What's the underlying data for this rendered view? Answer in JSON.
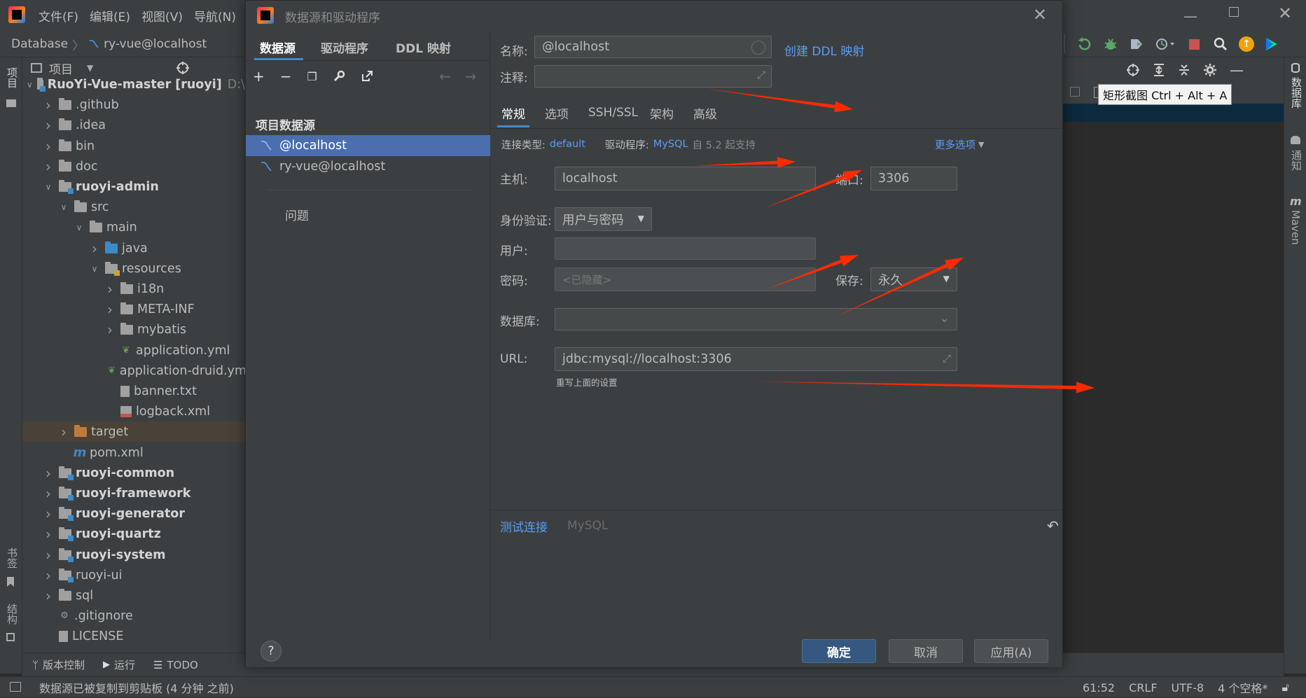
{
  "ide": {
    "menus": [
      "文件(F)",
      "编辑(E)",
      "视图(V)",
      "导航(N)"
    ],
    "breadcrumb": [
      "Database",
      "ry-vue@localhost"
    ],
    "project_header": "项目",
    "tooltip": "矩形截图 Ctrl + Alt + A",
    "left_strip": [
      "项目",
      "书签",
      "结构"
    ],
    "right_strip": [
      "数据库",
      "通知",
      "Maven"
    ],
    "tree": [
      {
        "label": "RuoYi-Vue-master",
        "suffix": "[ruoyi]",
        "path": "D:\\",
        "level": 0,
        "expanded": true,
        "icon": "module-folder",
        "bold": true
      },
      {
        "label": ".github",
        "level": 1,
        "icon": "folder"
      },
      {
        "label": ".idea",
        "level": 1,
        "icon": "folder"
      },
      {
        "label": "bin",
        "level": 1,
        "icon": "folder"
      },
      {
        "label": "doc",
        "level": 1,
        "icon": "folder"
      },
      {
        "label": "ruoyi-admin",
        "level": 1,
        "expanded": true,
        "icon": "module-folder",
        "bold": true
      },
      {
        "label": "src",
        "level": 2,
        "expanded": true,
        "icon": "folder"
      },
      {
        "label": "main",
        "level": 3,
        "expanded": true,
        "icon": "folder"
      },
      {
        "label": "java",
        "level": 4,
        "icon": "source-folder"
      },
      {
        "label": "resources",
        "level": 4,
        "expanded": true,
        "icon": "resources-folder"
      },
      {
        "label": "i18n",
        "level": 5,
        "icon": "folder"
      },
      {
        "label": "META-INF",
        "level": 5,
        "icon": "folder"
      },
      {
        "label": "mybatis",
        "level": 5,
        "icon": "folder"
      },
      {
        "label": "application.yml",
        "level": 5,
        "icon": "spring-config-file",
        "leaf": true
      },
      {
        "label": "application-druid.yml",
        "level": 5,
        "icon": "spring-config-file",
        "leaf": true
      },
      {
        "label": "banner.txt",
        "level": 5,
        "icon": "text-file",
        "leaf": true
      },
      {
        "label": "logback.xml",
        "level": 5,
        "icon": "xml-file",
        "leaf": true
      },
      {
        "label": "target",
        "level": 2,
        "icon": "excluded-folder",
        "highlight": true
      },
      {
        "label": "pom.xml",
        "level": 2,
        "icon": "maven-file",
        "leaf": true
      },
      {
        "label": "ruoyi-common",
        "level": 1,
        "icon": "module-folder",
        "bold": true
      },
      {
        "label": "ruoyi-framework",
        "level": 1,
        "icon": "module-folder",
        "bold": true
      },
      {
        "label": "ruoyi-generator",
        "level": 1,
        "icon": "module-folder",
        "bold": true
      },
      {
        "label": "ruoyi-quartz",
        "level": 1,
        "icon": "module-folder",
        "bold": true
      },
      {
        "label": "ruoyi-system",
        "level": 1,
        "icon": "module-folder",
        "bold": true
      },
      {
        "label": "ruoyi-ui",
        "level": 1,
        "icon": "module-folder"
      },
      {
        "label": "sql",
        "level": 1,
        "icon": "folder"
      },
      {
        "label": ".gitignore",
        "level": 1,
        "icon": "gitignore-file",
        "leaf": true
      },
      {
        "label": "LICENSE",
        "level": 1,
        "icon": "text-file",
        "leaf": true
      }
    ],
    "bottom_tools": [
      "版本控制",
      "运行",
      "TODO"
    ],
    "status": {
      "message": "数据源已被复制到剪贴板 (4 分钟 之前)",
      "position": "61:52",
      "line_sep": "CRLF",
      "encoding": "UTF-8",
      "indent": "4 个空格*"
    }
  },
  "dialog": {
    "title": "数据源和驱动程序",
    "tabs_left": [
      "数据源",
      "驱动程序",
      "DDL 映射"
    ],
    "section_title": "项目数据源",
    "datasources": [
      "@localhost",
      "ry-vue@localhost"
    ],
    "problems": "问题",
    "name_label": "名称:",
    "name_value": "@localhost",
    "create_ddl": "创建 DDL 映射",
    "comment_label": "注释:",
    "tabs": [
      "常规",
      "选项",
      "SSH/SSL",
      "架构",
      "高级"
    ],
    "conn_type_label": "连接类型:",
    "conn_type_value": "default",
    "driver_label": "驱动程序:",
    "driver_value": "MySQL",
    "driver_note": "自 5.2 起支持",
    "more_options": "更多选项",
    "host_label": "主机:",
    "host_value": "localhost",
    "port_label": "端口:",
    "port_value": "3306",
    "auth_label": "身份验证:",
    "auth_value": "用户与密码",
    "user_label": "用户:",
    "user_value": "",
    "password_label": "密码:",
    "password_placeholder": "<已隐藏>",
    "save_label": "保存:",
    "save_value": "永久",
    "database_label": "数据库:",
    "database_value": "",
    "url_label": "URL:",
    "url_value": "jdbc:mysql://localhost:3306",
    "url_note": "重写上面的设置",
    "test_connection": "测试连接",
    "test_driver": "MySQL",
    "help": "?",
    "ok": "确定",
    "cancel": "取消",
    "apply": "应用(A)"
  },
  "colors": {
    "accent": "#589df6",
    "selection": "#4b6eaf",
    "annotation_arrow": "#ff2a00",
    "primary_button": "#365880"
  }
}
